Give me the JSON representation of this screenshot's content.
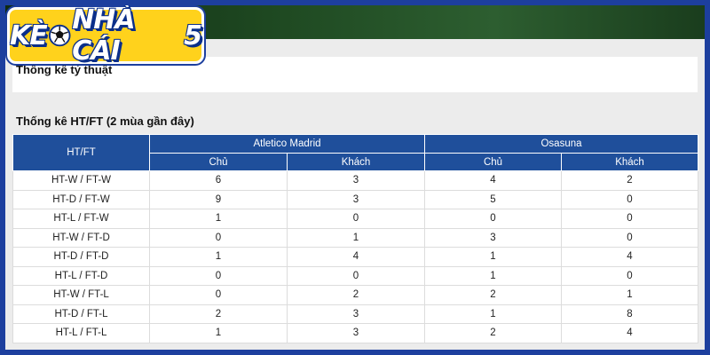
{
  "logo": {
    "text_part1": "KÈ",
    "text_part2": "NHÀ CÁI",
    "text_part3": "5"
  },
  "odds_section": {
    "title": "Thống kê tỷ thuật"
  },
  "htft_section": {
    "title": "Thống kê HT/FT (2 mùa gần đây)",
    "header": {
      "row_label": "HT/FT",
      "team1": "Atletico Madrid",
      "team2": "Osasuna",
      "home": "Chủ",
      "away": "Khách"
    },
    "rows": [
      {
        "label": "HT-W / FT-W",
        "values": [
          "6",
          "3",
          "4",
          "2"
        ]
      },
      {
        "label": "HT-D / FT-W",
        "values": [
          "9",
          "3",
          "5",
          "0"
        ]
      },
      {
        "label": "HT-L / FT-W",
        "values": [
          "1",
          "0",
          "0",
          "0"
        ]
      },
      {
        "label": "HT-W / FT-D",
        "values": [
          "0",
          "1",
          "3",
          "0"
        ]
      },
      {
        "label": "HT-D / FT-D",
        "values": [
          "1",
          "4",
          "1",
          "4"
        ]
      },
      {
        "label": "HT-L / FT-D",
        "values": [
          "0",
          "0",
          "1",
          "0"
        ]
      },
      {
        "label": "HT-W / FT-L",
        "values": [
          "0",
          "2",
          "2",
          "1"
        ]
      },
      {
        "label": "HT-D / FT-L",
        "values": [
          "2",
          "3",
          "1",
          "8"
        ]
      },
      {
        "label": "HT-L / FT-L",
        "values": [
          "1",
          "3",
          "2",
          "4"
        ]
      }
    ]
  }
}
